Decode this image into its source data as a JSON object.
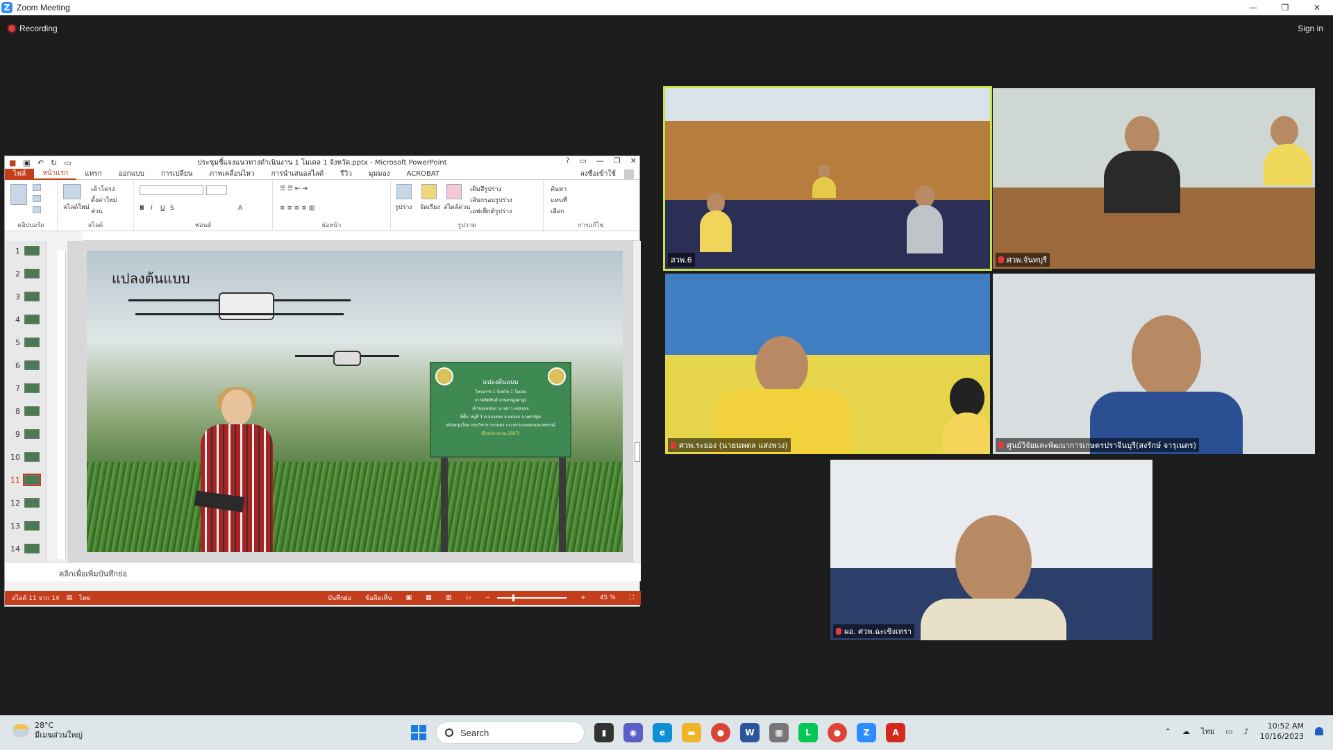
{
  "window": {
    "title": "Zoom Meeting",
    "minimize": "—",
    "maximize": "❐",
    "close": "✕"
  },
  "meeting": {
    "recording_label": "Recording",
    "sign_in_label": "Sign in"
  },
  "powerpoint": {
    "title": "ประชุมชี้แจงแนวทางดำเนินงาน 1 โมเดล 1 จังหวัด.pptx - Microsoft PowerPoint",
    "user": "ลงชื่อเข้าใช้",
    "tabs": [
      "ไฟล์",
      "หน้าแรก",
      "แทรก",
      "ออกแบบ",
      "การเปลี่ยน",
      "ภาพเคลื่อนไหว",
      "การนำเสนอสไลด์",
      "รีวิว",
      "มุมมอง",
      "ACROBAT"
    ],
    "ribbon_groups": [
      "คลิปบอร์ด",
      "สไลด์",
      "ฟอนต์",
      "ย่อหน้า",
      "รูปวาด",
      "การแก้ไข"
    ],
    "ribbon": {
      "new_slide": "สไลด์ใหม่",
      "layout": "เค้าโครง",
      "reset": "ตั้งค่าใหม่",
      "section": "ส่วน",
      "shapes": "รูปร่าง",
      "arrange": "จัดเรียง",
      "quick_styles": "สไตล์ด่วน",
      "shape_fill": "เติมสีรูปร่าง",
      "shape_outline": "เส้นกรอบรูปร่าง",
      "shape_effects": "เอฟเฟ็กต์รูปร่าง",
      "find": "ค้นหา",
      "replace": "แทนที่",
      "select": "เลือก"
    },
    "thumbnails": [
      "1",
      "2",
      "3",
      "4",
      "5",
      "6",
      "7",
      "8",
      "9",
      "10",
      "11",
      "12",
      "13",
      "14"
    ],
    "active_thumbnail": "11",
    "slide": {
      "title": "แปลงต้นแบบ",
      "sign_title": "แปลงต้นแบบ",
      "sign_line1": "โครงการ 1 จังหวัด 1 โมเดล",
      "sign_line2": "การผลิตสินค้าเกษตรมูลค่าสูง",
      "sign_line3": "เจ้าของแปลง: นางสาว xxxxxx",
      "sign_line4": "ที่ตั้ง: หมู่ที่ 1 ต.xxxxxx อ.xxxxx จ.นครปฐม",
      "sign_line5": "สนับสนุนโดย กรมวิชาการเกษตร กระทรวงเกษตรและสหกรณ์",
      "sign_line6": "(ปีงบประมาณ 2567)"
    },
    "notes_placeholder": "คลิกเพื่อเพิ่มบันทึกย่อ",
    "status": {
      "slide_of": "สไลด์ 11 จาก 14",
      "language": "ไทย",
      "notes_btn": "บันทึกย่อ",
      "comments_btn": "ข้อคิดเห็น",
      "zoom": "45 %"
    }
  },
  "participants": [
    {
      "name": "สวพ.6",
      "muted": false,
      "active": true
    },
    {
      "name": "ศวพ.จันทบุรี",
      "muted": true,
      "active": false
    },
    {
      "name": "ศวพ.ระยอง (นายนพดล แสงพวง)",
      "muted": true,
      "active": false
    },
    {
      "name": "ศูนย์วิจัยและพัฒนาการเกษตรปราจีนบุรี(สงรักษ์ จารุเนตร)",
      "muted": true,
      "active": false
    },
    {
      "name": "ผอ. ศวพ.ฉะเชิงเทรา",
      "muted": true,
      "active": false
    }
  ],
  "taskbar": {
    "weather_temp": "28°C",
    "weather_desc": "มีเมฆส่วนใหญ่",
    "search_placeholder": "Search",
    "language": "ไทย",
    "time": "10:52 AM",
    "date": "10/16/2023"
  }
}
